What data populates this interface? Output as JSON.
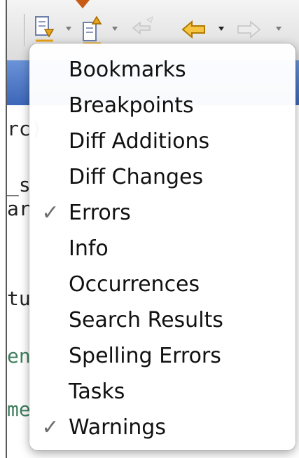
{
  "menu": {
    "items": [
      {
        "label": "Bookmarks",
        "checked": false
      },
      {
        "label": "Breakpoints",
        "checked": false
      },
      {
        "label": "Diff Additions",
        "checked": false
      },
      {
        "label": "Diff Changes",
        "checked": false
      },
      {
        "label": "Errors",
        "checked": true
      },
      {
        "label": "Info",
        "checked": false
      },
      {
        "label": "Occurrences",
        "checked": false
      },
      {
        "label": "Search Results",
        "checked": false
      },
      {
        "label": "Spelling Errors",
        "checked": false
      },
      {
        "label": "Tasks",
        "checked": false
      },
      {
        "label": "Warnings",
        "checked": true
      }
    ],
    "check_glyph": "✓"
  },
  "editor": {
    "code_fragments": [
      "rc)",
      "_s",
      "ar",
      "tu",
      "en",
      "me"
    ]
  },
  "colors": {
    "menu_background": "#ffffff",
    "check_color": "#6d6d6d",
    "toolbar_accent": "#c75a14",
    "editor_tabstrip": "#3d67b8"
  },
  "icons": {
    "toolbar": [
      "next-annotation-icon",
      "previous-annotation-icon",
      "last-edit-location-icon",
      "back-icon",
      "forward-icon"
    ]
  }
}
